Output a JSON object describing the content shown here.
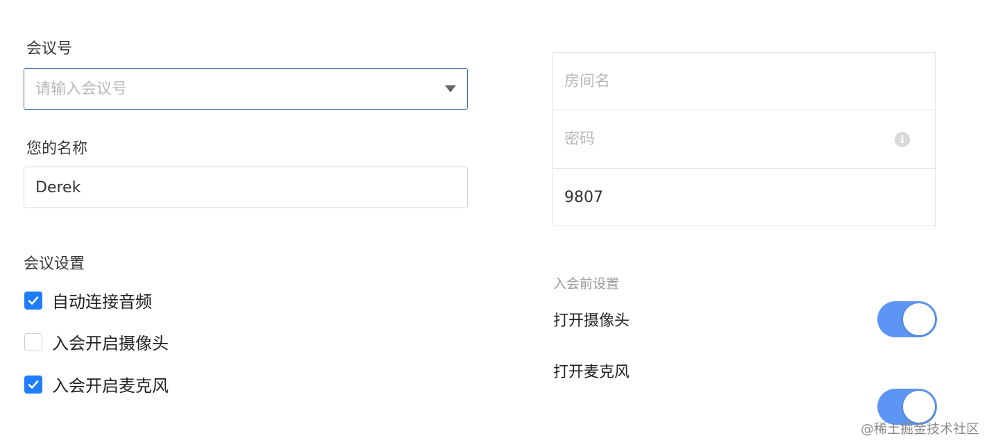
{
  "left": {
    "meeting_id_label": "会议号",
    "meeting_id_placeholder": "请输入会议号",
    "name_label": "您的名称",
    "name_value": "Derek",
    "settings_title": "会议设置",
    "options": [
      {
        "label": "自动连接音频",
        "checked": true
      },
      {
        "label": "入会开启摄像头",
        "checked": false
      },
      {
        "label": "入会开启麦克风",
        "checked": true
      }
    ]
  },
  "right": {
    "room_placeholder": "房间名",
    "password_placeholder": "密码",
    "room_code_value": "9807",
    "pre_join_title": "入会前设置",
    "toggles": [
      {
        "label": "打开摄像头",
        "on": true
      },
      {
        "label": "打开麦克风",
        "on": true
      }
    ]
  },
  "watermark": "@稀土掘金技术社区",
  "colors": {
    "checkbox_on": "#1f7dfb",
    "toggle_on": "#5c95f3",
    "focus_border": "#3b6fb6"
  }
}
